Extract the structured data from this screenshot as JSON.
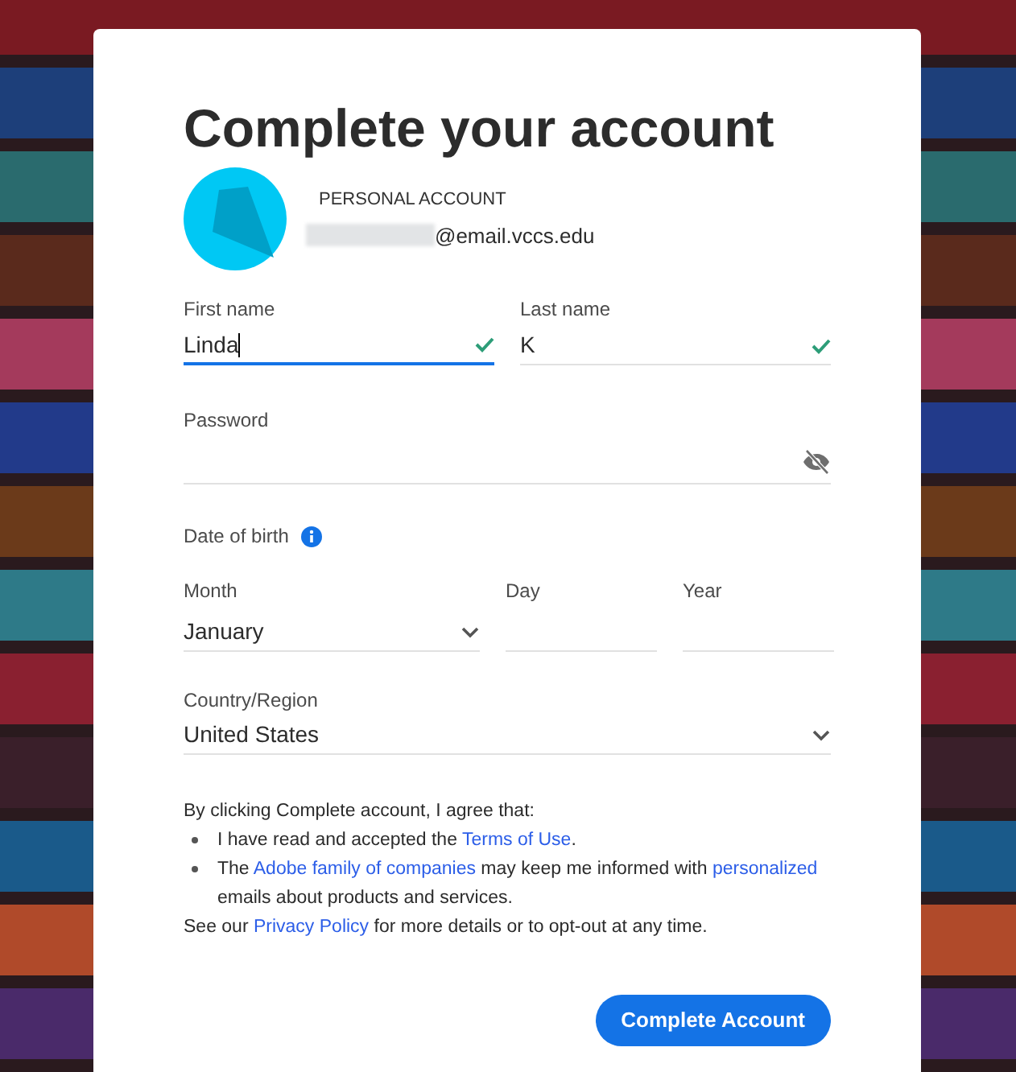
{
  "title": "Complete your account",
  "account": {
    "type": "PERSONAL ACCOUNT",
    "email": "@email.vccs.edu"
  },
  "name_fields": [
    {
      "label": "First name",
      "value": "Linda",
      "focused": true,
      "valid": true
    },
    {
      "label": "Last name",
      "value": "K",
      "focused": false,
      "valid": true
    }
  ],
  "password": {
    "label": "Password"
  },
  "date_of_birth": {
    "label": "Date of birth",
    "fields": [
      {
        "kind": "select",
        "label": "Month",
        "value": "January"
      },
      {
        "kind": "text",
        "label": "Day"
      },
      {
        "kind": "text",
        "label": "Year"
      }
    ]
  },
  "country": {
    "label": "Country/Region",
    "value": "United States"
  },
  "legal": {
    "intro": "By clicking Complete account, I agree that:",
    "bullets": [
      [
        {
          "text": "I have read and accepted the ",
          "link": false
        },
        {
          "text": "Terms of Use",
          "link": true
        },
        {
          "text": ".",
          "link": false
        }
      ],
      [
        {
          "text": "The ",
          "link": false
        },
        {
          "text": "Adobe family of companies",
          "link": true
        },
        {
          "text": " may keep me informed with ",
          "link": false
        },
        {
          "text": "personalized",
          "link": true
        },
        {
          "text": " emails about products and services.",
          "link": false
        }
      ]
    ],
    "footer": [
      {
        "text": "See our ",
        "link": false
      },
      {
        "text": "Privacy Policy",
        "link": true
      },
      {
        "text": " for more details or to opt-out at any time.",
        "link": false
      }
    ]
  },
  "submit": "Complete Account"
}
